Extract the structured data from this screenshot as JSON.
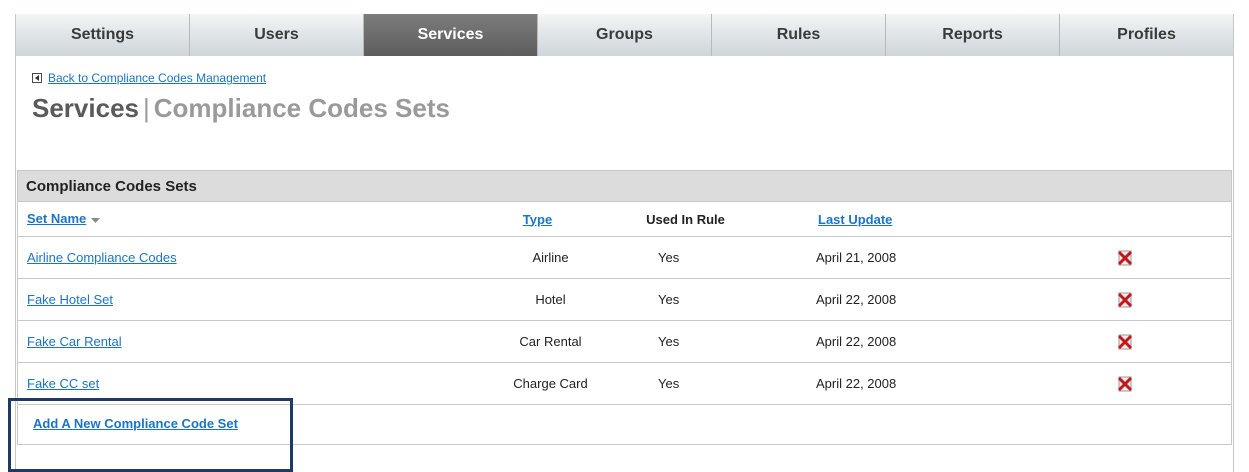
{
  "tabs": [
    {
      "label": "Settings"
    },
    {
      "label": "Users"
    },
    {
      "label": "Services",
      "active": true
    },
    {
      "label": "Groups"
    },
    {
      "label": "Rules"
    },
    {
      "label": "Reports"
    },
    {
      "label": "Profiles"
    }
  ],
  "back_link": "Back to Compliance Codes Management",
  "title": {
    "main": "Services",
    "separator": "|",
    "sub": "Compliance Codes Sets"
  },
  "panel": {
    "heading": "Compliance Codes Sets",
    "columns": {
      "set_name": "Set Name",
      "type": "Type",
      "used_in_rule": "Used In Rule",
      "last_update": "Last Update"
    },
    "rows": [
      {
        "set_name": "Airline Compliance Codes",
        "type": "Airline",
        "used_in_rule": "Yes",
        "last_update": "April 21, 2008"
      },
      {
        "set_name": "Fake Hotel Set",
        "type": "Hotel",
        "used_in_rule": "Yes",
        "last_update": "April 22, 2008"
      },
      {
        "set_name": "Fake Car Rental",
        "type": "Car Rental",
        "used_in_rule": "Yes",
        "last_update": "April 22, 2008"
      },
      {
        "set_name": "Fake CC set",
        "type": "Charge Card",
        "used_in_rule": "Yes",
        "last_update": "April 22, 2008"
      }
    ],
    "add_link": "Add A New Compliance Code Set"
  },
  "colors": {
    "link": "#1b74c6",
    "active_tab": "#666666",
    "highlight_border": "#1f3864",
    "delete_icon": "#c0181b"
  },
  "icons": {
    "back": "back-arrow-icon",
    "sort": "sort-down-icon",
    "delete": "delete-x-icon"
  }
}
